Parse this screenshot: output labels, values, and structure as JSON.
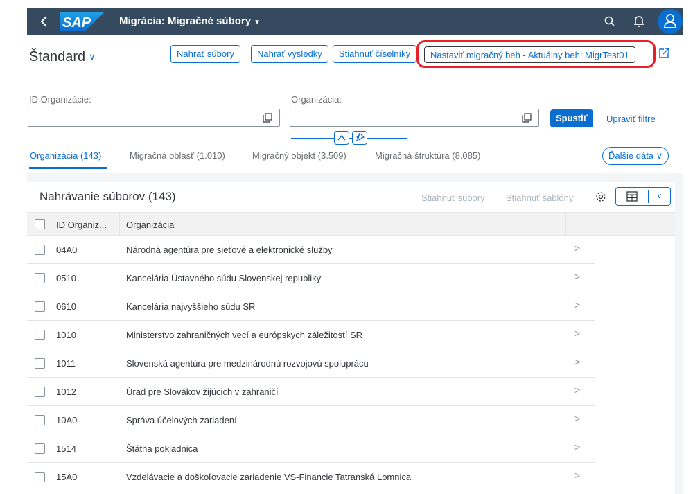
{
  "shell": {
    "title": "Migrácia: Migračné súbory",
    "logo_text": "SAP",
    "colors": {
      "shellbar": "#354a5f",
      "accent": "#0a6ed1",
      "avatar": "#0a6ed1",
      "highlight": "#e8202a"
    },
    "icons": [
      "back-icon",
      "search-icon",
      "bell-icon",
      "user-icon"
    ]
  },
  "variant": {
    "label": "Štandard"
  },
  "header_actions": {
    "upload_files": "Nahrať súbory",
    "upload_results": "Nahrať výsledky",
    "download_codelists": "Stiahnuť číselníky",
    "set_run": "Nastaviť migračný beh - Aktuálny beh: MigrTest01"
  },
  "filters": {
    "org_id_label": "ID Organizácie:",
    "org_id_value": "",
    "org_label": "Organizácia:",
    "org_value": "",
    "go": "Spustiť",
    "adapt": "Upraviť filtre"
  },
  "tabs": [
    {
      "label": "Organizácia (143)",
      "active": true
    },
    {
      "label": "Migračná oblasť (1.010)",
      "active": false
    },
    {
      "label": "Migračný objekt (3.509)",
      "active": false
    },
    {
      "label": "Migračná štruktúra (8.085)",
      "active": false
    }
  ],
  "more_data": "Ďalšie dáta",
  "table": {
    "title": "Nahrávanie súborov (143)",
    "download_files": "Stiahnuť súbory",
    "download_templates": "Stiahnuť šablóny",
    "columns": [
      "ID Organiz...",
      "Organizácia"
    ],
    "rows": [
      {
        "id": "04A0",
        "org": "Národná agentúra pre sieťové a elektronické služby"
      },
      {
        "id": "0510",
        "org": "Kancelária Ústavného súdu Slovenskej republiky"
      },
      {
        "id": "0610",
        "org": "Kancelária najvyššieho súdu SR"
      },
      {
        "id": "1010",
        "org": "Ministerstvo zahraničných vecí a európskych záležitostí SR"
      },
      {
        "id": "1011",
        "org": "Slovenská agentúra pre medzinárodnú rozvojovú spoluprácu"
      },
      {
        "id": "1012",
        "org": "Úrad pre Slovákov žijúcich v zahraničí"
      },
      {
        "id": "10A0",
        "org": "Správa účelových zariadení"
      },
      {
        "id": "1514",
        "org": "Štátna pokladnica"
      },
      {
        "id": "15A0",
        "org": "Vzdelávacie a doškoľovacie zariadenie VS-Financie Tatranská Lomnica"
      }
    ]
  }
}
